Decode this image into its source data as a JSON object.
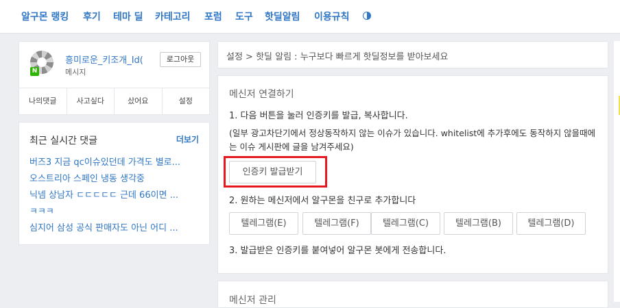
{
  "nav": {
    "items": [
      "알구몬 랭킹",
      "후기",
      "테마 딜",
      "카테고리",
      "포럼",
      "도구",
      "핫딜알림",
      "이용규칙"
    ],
    "theme_icon": "contrast-icon"
  },
  "profile": {
    "username": "흥미로운_키조개_Id(",
    "message_link": "메시지",
    "logout": "로그아웃",
    "badge": "N",
    "tabs": [
      "나의댓글",
      "사고싶다",
      "샀어요",
      "설정"
    ]
  },
  "recent": {
    "title": "최근 실시간 댓글",
    "more": "더보기",
    "items": [
      "버즈3 지금 qc이슈있던데 가격도 별로...",
      "오스트리아 스페인 냉동 생각중",
      "닉넴 상남자 ㄷㄷㄷㄷㄷ 근데 66이면 ...",
      "ㅋㅋㅋ",
      "심지어 삼성 공식 판매자도 아닌 어디 ..."
    ]
  },
  "breadcrumb": "설정 > 핫딜 알림 : 누구보다 빠르게 핫딜정보를 받아보세요",
  "messenger": {
    "heading": "메신저 연결하기",
    "step1": "1. 다음 버튼을 눌러 인증키를 발급, 복사합니다.",
    "note": "(일부 광고차단기에서 정상동작하지 않는 이슈가 있습니다. whitelist에 추가후에도 동작하지 않을때에는 이슈 게시판에 글을 남겨주세요)",
    "issue_key_button": "인증키 발급받기",
    "step2": "2. 원하는 메신저에서 알구몬을 친구로 추가합니다",
    "telegram_buttons": [
      "텔레그램(E)",
      "텔레그램(F)",
      "텔레그램(C)",
      "텔레그램(B)",
      "텔레그램(D)"
    ],
    "step3": "3. 발급받은 인증키를 붙여넣어 알구몬 봇에게 전송합니다."
  },
  "manage": {
    "heading": "메신저 관리"
  },
  "colors": {
    "accent": "#2f76c5",
    "highlight": "#e5171f",
    "naver_green": "#2db400"
  }
}
